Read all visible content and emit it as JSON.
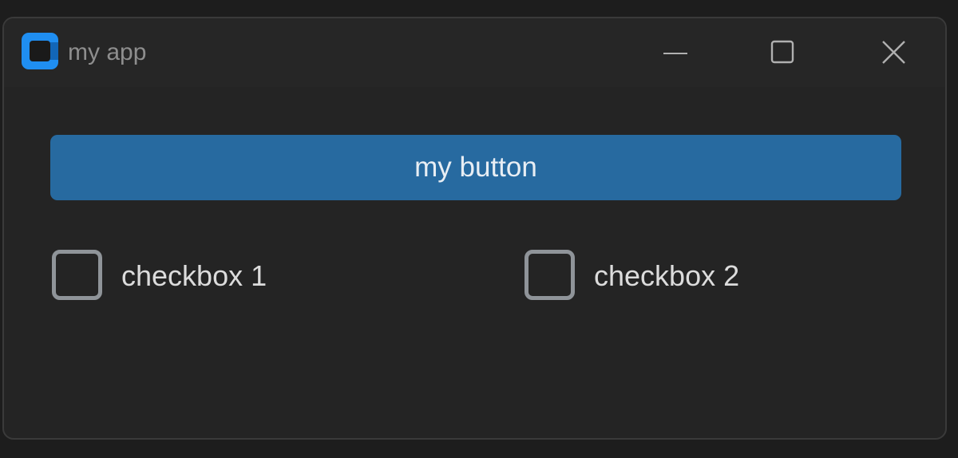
{
  "window": {
    "title": "my app",
    "controls": {
      "minimize": "minimize-icon",
      "maximize": "maximize-icon",
      "close": "close-icon"
    },
    "colors": {
      "background": "#242424",
      "accent": "#276aa0",
      "app_icon": "#1f8ef1"
    }
  },
  "main": {
    "button_label": "my button",
    "checkboxes": [
      {
        "label": "checkbox 1",
        "checked": false
      },
      {
        "label": "checkbox 2",
        "checked": false
      }
    ]
  }
}
